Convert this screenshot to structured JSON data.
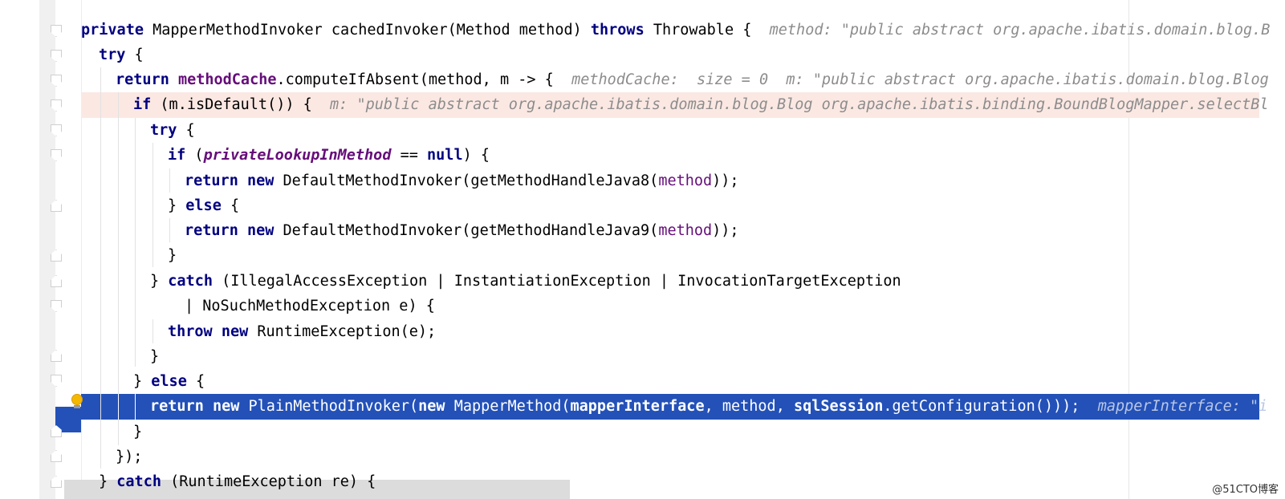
{
  "editor": {
    "lines": [
      {
        "s1": "private",
        "s2": " MapperMethodInvoker cachedInvoker(Method method) ",
        "s3": "throws",
        "s4": " Throwable {",
        "hint": "method: \"public abstract org.apache.ibatis.domain.blog.B"
      },
      {
        "s1": "try",
        "s2": " {"
      },
      {
        "s1": "return",
        "s2": " ",
        "s3": "methodCache",
        "s4": ".computeIfAbsent(method, m -> {",
        "hint": "methodCache:  size = 0  m: \"public abstract org.apache.ibatis.domain.blog.Blog"
      },
      {
        "s1": "if",
        "s2": " (m.isDefault()) {",
        "hint": "m: \"public abstract org.apache.ibatis.domain.blog.Blog org.apache.ibatis.binding.BoundBlogMapper.selectBl"
      },
      {
        "s1": "try",
        "s2": " {"
      },
      {
        "s1": "if",
        "s2": " (",
        "s3": "privateLookupInMethod",
        "s4": " == ",
        "s5": "null",
        "s6": ") {"
      },
      {
        "s1": "return",
        "s2": " ",
        "s3": "new",
        "s4": " DefaultMethodInvoker(getMethodHandleJava8(",
        "s5": "method",
        "s6": "));"
      },
      {
        "s1": "}",
        "s2": " else",
        "s3": " {"
      },
      {
        "s1": "return",
        "s2": " ",
        "s3": "new",
        "s4": " DefaultMethodInvoker(getMethodHandleJava9(",
        "s5": "method",
        "s6": "));"
      },
      {
        "s1": "}"
      },
      {
        "s1": "} ",
        "s2": "catch",
        "s3": " (IllegalAccessException | InstantiationException | InvocationTargetException"
      },
      {
        "s1": "| NoSuchMethodException e) {"
      },
      {
        "s1": "throw",
        "s2": " ",
        "s3": "new",
        "s4": " RuntimeException(e);"
      },
      {
        "s1": "}"
      },
      {
        "s1": "} ",
        "s2": "else",
        "s3": " {"
      },
      {
        "s1": "return",
        "s2": " ",
        "s3": "new",
        "s4": " PlainMethodInvoker(",
        "s5": "new",
        "s6": " MapperMethod(",
        "s7": "mapperInterface",
        "s8": ", method, ",
        "s9": "sqlSession",
        "s10": ".getConfiguration()));",
        "hint": "mapperInterface: \"i"
      },
      {
        "s1": "}"
      },
      {
        "s1": "});"
      },
      {
        "s1": "} ",
        "s2": "catch",
        "s3": " (RuntimeException re) {"
      }
    ]
  },
  "watermark": "@51CTO博客",
  "colors": {
    "keyword": "#000080",
    "field": "#660e7a",
    "hint": "#8c8c8c",
    "execution": "#2351b8",
    "error": "#fbe8e3"
  }
}
